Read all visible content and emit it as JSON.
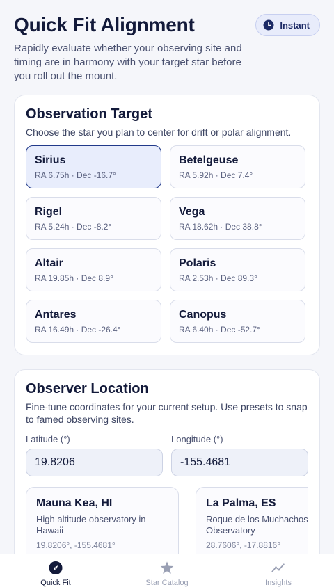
{
  "header": {
    "title": "Quick Fit Alignment",
    "badge": "Instant",
    "subtitle": "Rapidly evaluate whether your observing site and timing are in harmony with your target star before you roll out the mount."
  },
  "target": {
    "title": "Observation Target",
    "description": "Choose the star you plan to center for drift or polar alignment.",
    "stars": [
      {
        "name": "Sirius",
        "coords": "RA 6.75h · Dec -16.7°",
        "selected": true
      },
      {
        "name": "Betelgeuse",
        "coords": "RA 5.92h · Dec 7.4°",
        "selected": false
      },
      {
        "name": "Rigel",
        "coords": "RA 5.24h · Dec -8.2°",
        "selected": false
      },
      {
        "name": "Vega",
        "coords": "RA 18.62h · Dec 38.8°",
        "selected": false
      },
      {
        "name": "Altair",
        "coords": "RA 19.85h · Dec 8.9°",
        "selected": false
      },
      {
        "name": "Polaris",
        "coords": "RA 2.53h · Dec 89.3°",
        "selected": false
      },
      {
        "name": "Antares",
        "coords": "RA 16.49h · Dec -26.4°",
        "selected": false
      },
      {
        "name": "Canopus",
        "coords": "RA 6.40h · Dec -52.7°",
        "selected": false
      }
    ]
  },
  "location": {
    "title": "Observer Location",
    "description": "Fine-tune coordinates for your current setup. Use presets to snap to famed observing sites.",
    "latitude": {
      "label": "Latitude (°)",
      "value": "19.8206"
    },
    "longitude": {
      "label": "Longitude (°)",
      "value": "-155.4681"
    },
    "presets": [
      {
        "name": "Mauna Kea, HI",
        "description": "High altitude observatory in Hawaii",
        "coords": "19.8206°, -155.4681°"
      },
      {
        "name": "La Palma, ES",
        "description": "Roque de los Muchachos Observatory",
        "coords": "28.7606°, -17.8816°"
      }
    ]
  },
  "tabbar": {
    "tabs": [
      {
        "label": "Quick Fit",
        "icon": "compass-icon",
        "active": true
      },
      {
        "label": "Star Catalog",
        "icon": "star-icon",
        "active": false
      },
      {
        "label": "Insights",
        "icon": "trend-line-icon",
        "active": false
      }
    ]
  },
  "colors": {
    "accent": "#223a8a",
    "selected_bg": "#e8edfc",
    "text": "#131a3a",
    "muted": "#4a5170"
  }
}
